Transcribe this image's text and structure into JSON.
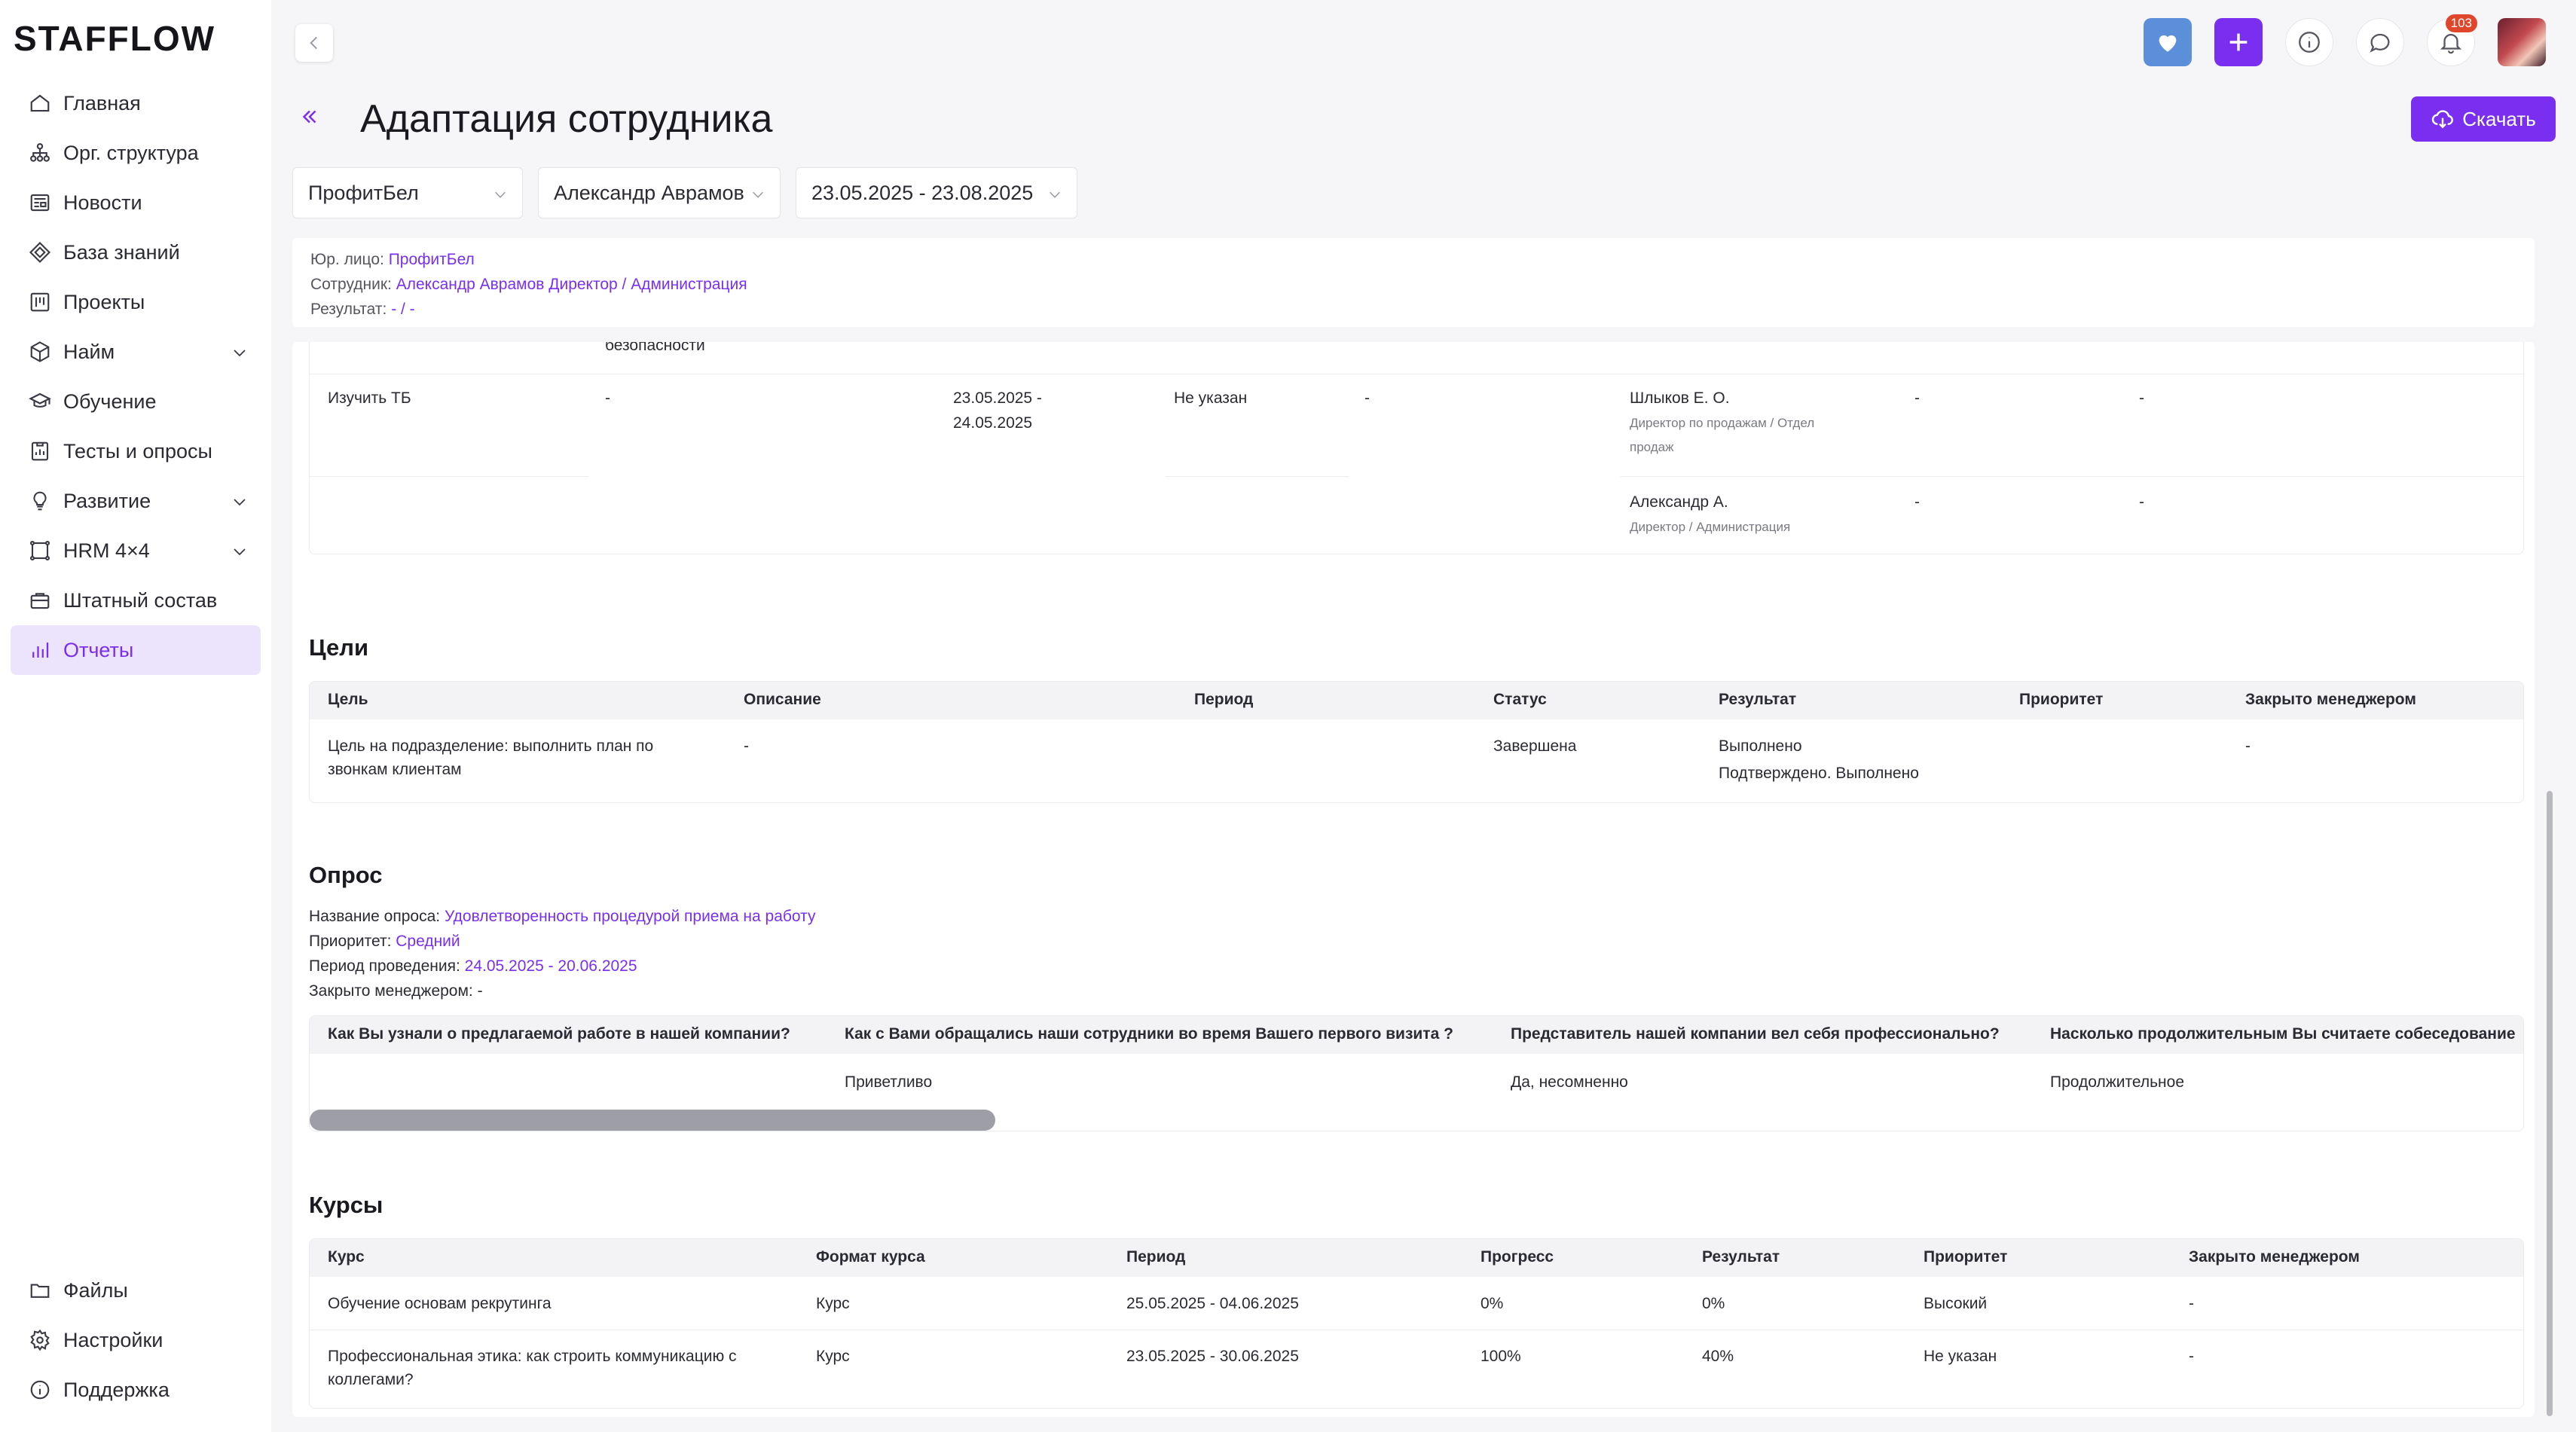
{
  "app": {
    "logo": "STAFFLOW"
  },
  "sidebar": {
    "items": [
      {
        "label": "Главная",
        "icon": "home-icon"
      },
      {
        "label": "Орг. структура",
        "icon": "org-structure-icon"
      },
      {
        "label": "Новости",
        "icon": "news-icon"
      },
      {
        "label": "База знаний",
        "icon": "knowledge-base-icon"
      },
      {
        "label": "Проекты",
        "icon": "projects-icon"
      },
      {
        "label": "Найм",
        "icon": "hiring-icon"
      },
      {
        "label": "Обучение",
        "icon": "education-icon"
      },
      {
        "label": "Тесты и опросы",
        "icon": "tests-icon"
      },
      {
        "label": "Развитие",
        "icon": "development-icon"
      },
      {
        "label": "HRM 4×4",
        "icon": "hrm-icon"
      },
      {
        "label": "Штатный состав",
        "icon": "staff-icon"
      },
      {
        "label": "Отчеты",
        "icon": "reports-icon"
      }
    ],
    "bottom": [
      {
        "label": "Файлы",
        "icon": "folder-icon"
      },
      {
        "label": "Настройки",
        "icon": "settings-icon"
      },
      {
        "label": "Поддержка",
        "icon": "support-icon"
      }
    ]
  },
  "topbar": {
    "notifications_count": "103"
  },
  "header": {
    "title": "Адаптация сотрудника",
    "download_label": "Скачать"
  },
  "filters": {
    "company": "ПрофитБел",
    "employee": "Александр Аврамов",
    "period": "23.05.2025 - 23.08.2025"
  },
  "info": {
    "legal_label": "Юр. лицо:",
    "legal_value": "ПрофитБел",
    "employee_label": "Сотрудник:",
    "employee_value": "Александр Аврамов Директор / Администрация",
    "result_label": "Результат:",
    "result_value": "- / -"
  },
  "tasks": {
    "partial_text": "безопасности",
    "row": {
      "task": "Изучить ТБ",
      "description": "-",
      "period_1": "23.05.2025 -",
      "period_2": "24.05.2025",
      "status": "Не указан",
      "col5": "-"
    },
    "responsibles": [
      {
        "name": "Шлыков Е. О.",
        "role_1": "Директор по продажам / Отдел",
        "role_2": "продаж",
        "c1": "-",
        "c2": "-"
      },
      {
        "name": "Александр А.",
        "role_1": "Директор / Администрация",
        "role_2": "",
        "c1": "-",
        "c2": "-"
      }
    ]
  },
  "goals": {
    "title": "Цели",
    "columns": [
      "Цель",
      "Описание",
      "Период",
      "Статус",
      "Результат",
      "Приоритет",
      "Закрыто менеджером"
    ],
    "row": {
      "goal_1": "Цель на подразделение: выполнить план по",
      "goal_2": "звонкам клиентам",
      "description": "-",
      "status": "Завершена",
      "result": "Выполнено",
      "result_sub": "Подтверждено. Выполнено",
      "closed": "-"
    }
  },
  "survey": {
    "title": "Опрос",
    "name_label": "Название опроса:",
    "name_value": "Удовлетворенность процедурой приема на работу",
    "priority_label": "Приоритет:",
    "priority_value": "Средний",
    "period_label": "Период проведения:",
    "period_value": "24.05.2025 - 20.06.2025",
    "closed_label": "Закрыто менеджером:",
    "closed_value": "-",
    "columns": [
      "Как Вы узнали о предлагаемой работе в нашей компании?",
      "Как с Вами обращались наши сотрудники во время Вашего первого визита ?",
      "Представитель нашей компании вел себя профессионально?",
      "Насколько продолжительным Вы считаете собеседование"
    ],
    "answers": [
      "",
      "Приветливо",
      "Да, несомненно",
      "Продолжительное"
    ]
  },
  "courses": {
    "title": "Курсы",
    "columns": [
      "Курс",
      "Формат курса",
      "Период",
      "Прогресс",
      "Результат",
      "Приоритет",
      "Закрыто менеджером"
    ],
    "rows": [
      {
        "course_1": "Обучение основам рекрутинга",
        "course_2": "",
        "format": "Курс",
        "period": "25.05.2025 - 04.06.2025",
        "progress": "0%",
        "result": "0%",
        "priority": "Высокий",
        "closed": "-"
      },
      {
        "course_1": "Профессиональная этика: как строить коммуникацию с",
        "course_2": "коллегами?",
        "format": "Курс",
        "period": "23.05.2025 - 30.06.2025",
        "progress": "100%",
        "result": "40%",
        "priority": "Не указан",
        "closed": "-"
      }
    ]
  },
  "colors": {
    "accent": "#7a2ff0",
    "heart_button": "#5b8fd9",
    "badge": "#e0462b"
  }
}
